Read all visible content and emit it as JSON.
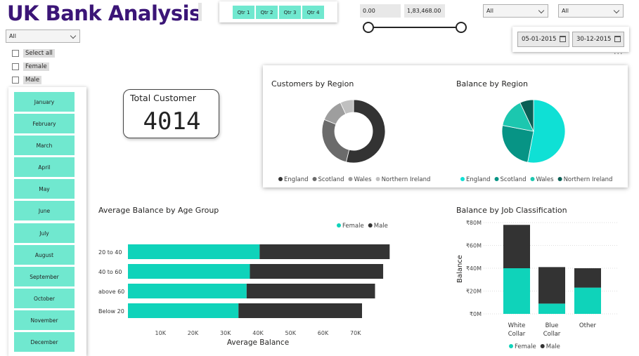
{
  "header": {
    "title": "UK Bank Analysis"
  },
  "quarters": [
    "Qtr 1",
    "Qtr 2",
    "Qtr 3",
    "Qtr 4"
  ],
  "balance_slider": {
    "min_value": "0.00",
    "max_value": "1,83,468.00",
    "low_fraction": 0.0,
    "high_fraction": 1.0
  },
  "dropdowns": {
    "left": "All",
    "right": "All",
    "gender": "All"
  },
  "date_range": {
    "start": "05-01-2015",
    "end": "30-12-2015"
  },
  "more_options": "···",
  "gender_filter": [
    "Select all",
    "Female",
    "Male"
  ],
  "months": [
    "January",
    "February",
    "March",
    "April",
    "May",
    "June",
    "July",
    "August",
    "September",
    "October",
    "November",
    "December"
  ],
  "kpi": {
    "label": "Total Customer",
    "value": "4014"
  },
  "colors": {
    "teal": "#0fd3ba",
    "dark": "#333333",
    "accent_title": "#3b1577",
    "slicer": "#70e8cf"
  },
  "chart_data": [
    {
      "type": "donut",
      "title": "Customers by Region",
      "categories": [
        "England",
        "Scotland",
        "Wales",
        "Northern Ireland"
      ],
      "values": [
        2159,
        1095,
        485,
        275
      ],
      "colors": [
        "#333333",
        "#6b6b6b",
        "#9e9e9e",
        "#c0c0c0"
      ]
    },
    {
      "type": "pie",
      "title": "Balance by Region",
      "categories": [
        "England",
        "Scotland",
        "Wales",
        "Northern Ireland"
      ],
      "values": [
        53,
        25,
        15,
        7
      ],
      "colors": [
        "#0fe0d5",
        "#079485",
        "#1cc7af",
        "#0a5f55"
      ]
    },
    {
      "type": "bar",
      "orientation": "horizontal",
      "stacked": true,
      "title": "Average Balance by Age Group",
      "xlabel": "Average Balance",
      "categories": [
        "20 to 40",
        "40 to 60",
        "above 60",
        "Below 20"
      ],
      "series": [
        {
          "name": "Female",
          "values": [
            40500,
            37500,
            36500,
            34000
          ],
          "color": "#0fd3ba"
        },
        {
          "name": "Male",
          "values": [
            40000,
            41000,
            39500,
            38000
          ],
          "color": "#333333"
        }
      ],
      "xticks": [
        "10K",
        "20K",
        "30K",
        "40K",
        "50K",
        "60K",
        "70K"
      ],
      "xlim": [
        0,
        80000
      ]
    },
    {
      "type": "bar",
      "stacked": true,
      "title": "Balance by Job Classification",
      "ylabel": "Balance",
      "categories": [
        "White Collar",
        "Blue Collar",
        "Other"
      ],
      "series": [
        {
          "name": "Female",
          "values": [
            40,
            9,
            23
          ],
          "color": "#0fd3ba"
        },
        {
          "name": "Male",
          "values": [
            38,
            32,
            17
          ],
          "color": "#333333"
        }
      ],
      "yticks": [
        "₹0M",
        "₹20M",
        "₹40M",
        "₹60M",
        "₹80M"
      ],
      "ylim": [
        0,
        80
      ],
      "unit": "M"
    }
  ]
}
